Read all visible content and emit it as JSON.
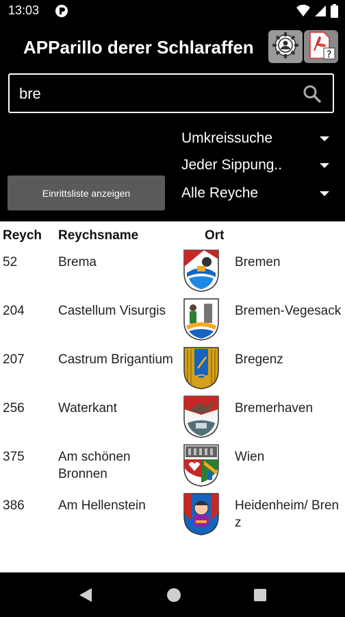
{
  "status": {
    "time": "13:03"
  },
  "app": {
    "title": "APParillo derer Schlaraffen"
  },
  "search": {
    "value": "bre"
  },
  "filters": {
    "radius": "Umkreissuche",
    "meeting": "Jeder Sippung..",
    "region": "Alle Reyche"
  },
  "buttons": {
    "entry_list": "Einrittsliste anzeigen"
  },
  "table": {
    "headers": {
      "num": "Reych",
      "name": "Reychsname",
      "place": "Ort"
    },
    "rows": [
      {
        "num": "52",
        "name": "Brema",
        "place": "Bremen"
      },
      {
        "num": "204",
        "name": "Castellum Visurgis",
        "place": "Bremen-Vegesack"
      },
      {
        "num": "207",
        "name": "Castrum Brigantium",
        "place": "Bregenz"
      },
      {
        "num": "256",
        "name": "Waterkant",
        "place": "Bremerhaven"
      },
      {
        "num": "375",
        "name": "Am schönen Bronnen",
        "place": "Wien"
      },
      {
        "num": "386",
        "name": "Am Hellenstein",
        "place": "Heidenheim/ Brenz"
      }
    ]
  },
  "icons": {
    "settings": "gear-person-icon",
    "pdf": "pdf-help-icon",
    "search": "search-icon",
    "nav_back": "back-triangle-icon",
    "nav_home": "home-circle-icon",
    "nav_recents": "recents-square-icon"
  },
  "colors": {
    "background": "#000000",
    "button": "#5a5a5a",
    "pdf_red": "#d32f2f"
  }
}
